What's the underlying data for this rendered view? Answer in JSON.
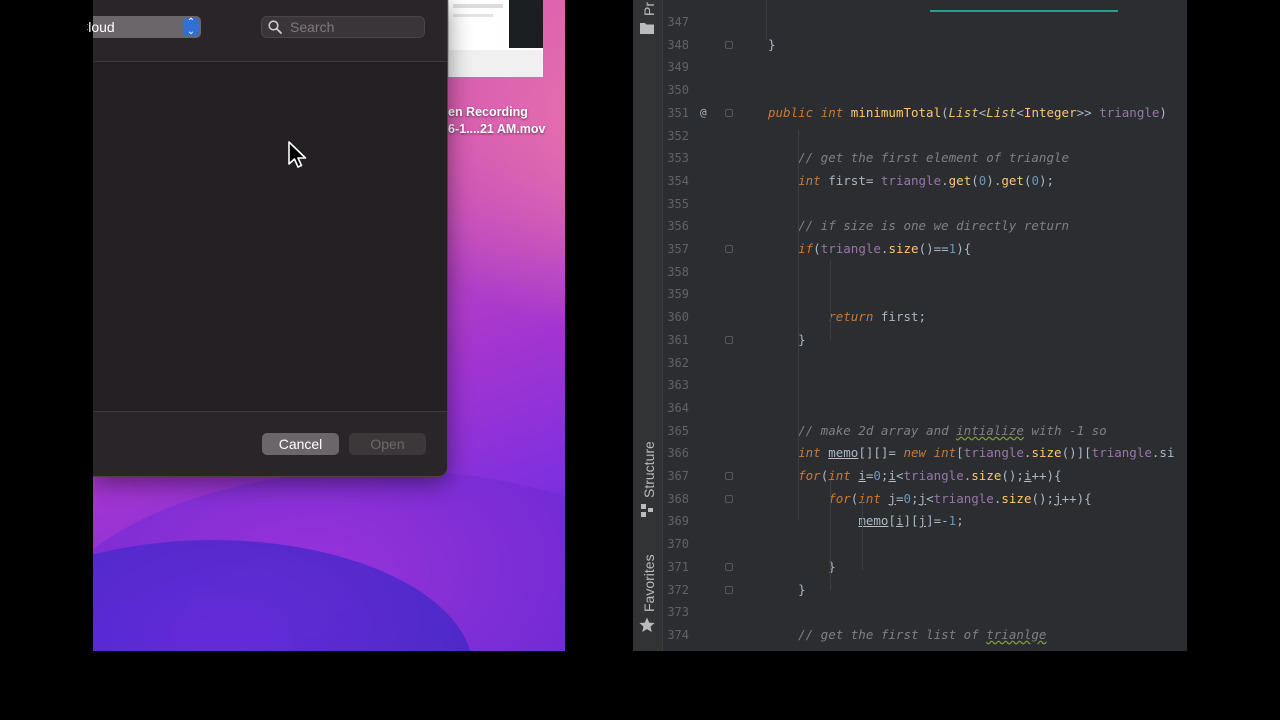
{
  "dialog": {
    "location_label": "iCloud",
    "search_placeholder": "Search",
    "cancel_label": "Cancel",
    "open_label": "Open"
  },
  "desktop": {
    "file_label_line1": "en Recording",
    "file_label_line2": "6-1....21 AM.mov"
  },
  "ide": {
    "toolwindows": {
      "project": "Pr",
      "structure": "Structure",
      "favorites": "Favorites"
    },
    "lines": [
      {
        "n": "347",
        "html": ""
      },
      {
        "n": "348",
        "html": "}"
      },
      {
        "n": "349",
        "html": ""
      },
      {
        "n": "350",
        "html": ""
      },
      {
        "n": "351",
        "html": "public int minimumTotal(List<List<Integer>> triangle)"
      },
      {
        "n": "352",
        "html": ""
      },
      {
        "n": "353",
        "html": "    // get the first element of triangle"
      },
      {
        "n": "354",
        "html": "    int first= triangle.get(0).get(0);"
      },
      {
        "n": "355",
        "html": ""
      },
      {
        "n": "356",
        "html": "    // if size is one we directly return"
      },
      {
        "n": "357",
        "html": "    if(triangle.size()==1){"
      },
      {
        "n": "358",
        "html": ""
      },
      {
        "n": "359",
        "html": ""
      },
      {
        "n": "360",
        "html": "        return first;"
      },
      {
        "n": "361",
        "html": "    }"
      },
      {
        "n": "362",
        "html": ""
      },
      {
        "n": "363",
        "html": ""
      },
      {
        "n": "364",
        "html": ""
      },
      {
        "n": "365",
        "html": "    // make 2d array and intialize with -1 so"
      },
      {
        "n": "366",
        "html": "    int memo[][]= new int[triangle.size()][triangle.si"
      },
      {
        "n": "367",
        "html": "    for(int i=0;i<triangle.size();i++){"
      },
      {
        "n": "368",
        "html": "        for(int j=0;j<triangle.size();j++){"
      },
      {
        "n": "369",
        "html": "            memo[i][j]=-1;"
      },
      {
        "n": "370",
        "html": ""
      },
      {
        "n": "371",
        "html": "        }"
      },
      {
        "n": "372",
        "html": "    }"
      },
      {
        "n": "373",
        "html": ""
      },
      {
        "n": "374",
        "html": "    // get the first list of trianlge"
      }
    ]
  }
}
